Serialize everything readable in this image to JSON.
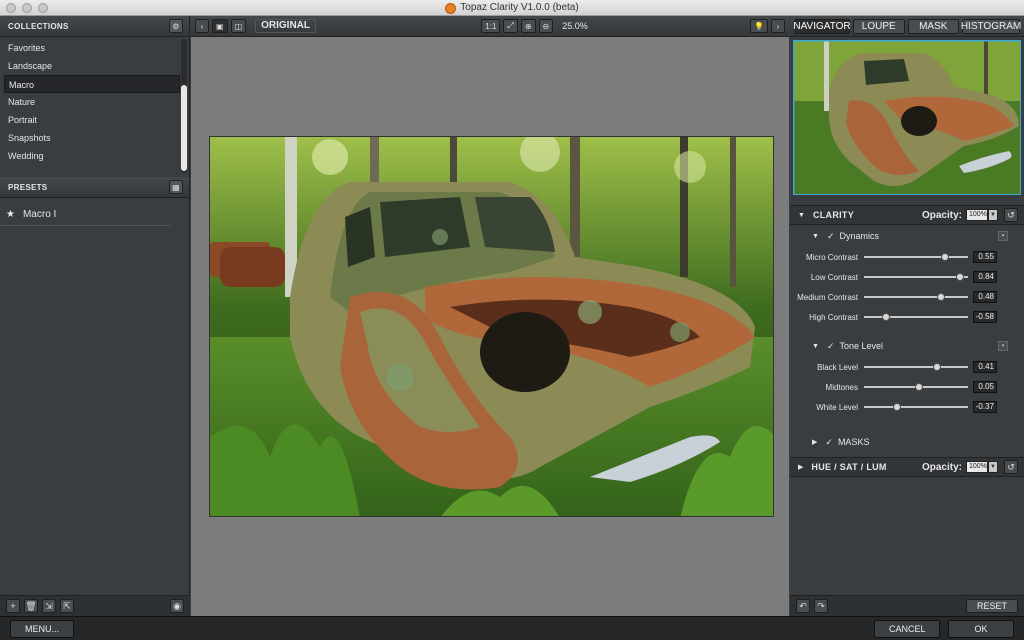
{
  "window": {
    "title": "Topaz Clarity V1.0.0 (beta)"
  },
  "collections": {
    "header": "COLLECTIONS",
    "items": [
      "Favorites",
      "Landscape",
      "Macro",
      "Nature",
      "Portrait",
      "Snapshots",
      "Wedding"
    ],
    "active_index": 2
  },
  "presets": {
    "header": "PRESETS",
    "items": [
      "Macro I"
    ]
  },
  "toolbar": {
    "original_label": "ORIGINAL",
    "one_to_one": "1:1",
    "zoom": "25.0%"
  },
  "tabs": {
    "navigator": "NAVIGATOR",
    "loupe": "LOUPE",
    "mask": "MASK",
    "histogram": "HISTOGRAM"
  },
  "clarity": {
    "title": "CLARITY",
    "opacity_label": "Opacity:",
    "opacity_value": "100%",
    "dynamics": {
      "label": "Dynamics",
      "sliders": [
        {
          "name": "Micro Contrast",
          "value": "0.55",
          "pos": 0.55
        },
        {
          "name": "Low Contrast",
          "value": "0.84",
          "pos": 0.84
        },
        {
          "name": "Medium Contrast",
          "value": "0.48",
          "pos": 0.48
        },
        {
          "name": "High Contrast",
          "value": "-0.58",
          "pos": -0.58
        }
      ]
    },
    "tone": {
      "label": "Tone Level",
      "sliders": [
        {
          "name": "Black Level",
          "value": "0.41",
          "pos": 0.41
        },
        {
          "name": "Midtones",
          "value": "0.05",
          "pos": 0.05
        },
        {
          "name": "White Level",
          "value": "-0.37",
          "pos": -0.37
        }
      ]
    },
    "masks_label": "MASKS"
  },
  "hsl": {
    "title": "HUE / SAT / LUM",
    "opacity_label": "Opacity:",
    "opacity_value": "100%"
  },
  "right_footer": {
    "reset": "RESET"
  },
  "footer": {
    "menu": "MENU...",
    "cancel": "CANCEL",
    "ok": "OK"
  },
  "colors": {
    "accent": "#3ba9d6",
    "panel": "#3a3d40",
    "canvas": "#7c7c7c"
  }
}
